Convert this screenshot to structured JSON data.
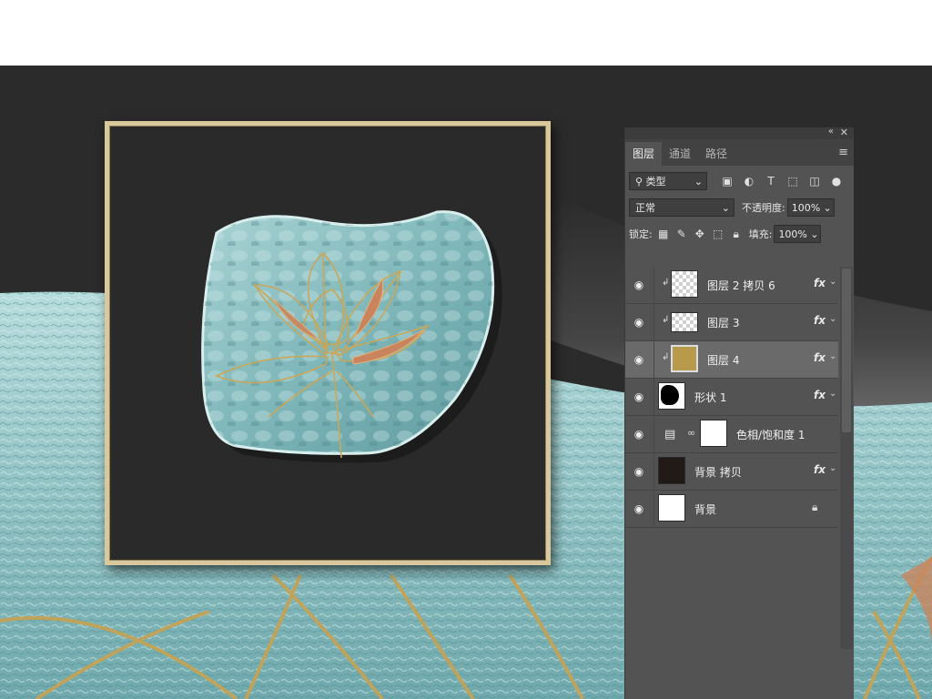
{
  "top_title": "",
  "panel": {
    "tabs": [
      {
        "label": "图层",
        "active": true
      },
      {
        "label": "通道",
        "active": false
      },
      {
        "label": "路径",
        "active": false
      }
    ],
    "filter_kind": "类型",
    "blend_mode": "正常",
    "opacity_label": "不透明度:",
    "opacity_value": "100%",
    "lock_label": "锁定:",
    "fill_label": "填充:",
    "fill_value": "100%",
    "layers": [
      {
        "name": "图层 2 拷贝 6",
        "fx": "fx",
        "clipped": true,
        "selected": false
      },
      {
        "name": "图层 3",
        "fx": "fx",
        "clipped": true,
        "selected": false
      },
      {
        "name": "图层 4",
        "fx": "fx",
        "clipped": true,
        "selected": true
      },
      {
        "name": "形状 1",
        "fx": "fx",
        "clipped": false,
        "selected": false
      },
      {
        "name": "色相/饱和度 1",
        "fx": "",
        "clipped": false,
        "selected": false
      },
      {
        "name": "背景 拷贝",
        "fx": "fx",
        "clipped": false,
        "selected": false
      },
      {
        "name": "背景",
        "fx": "",
        "clipped": false,
        "selected": false
      }
    ]
  },
  "colors": {
    "canvas_dark": "#2b2b2b",
    "teal_texture": "#8fc2c4",
    "gold_line": "#c9a75a",
    "copper_petal": "#c9845e",
    "panel_bg": "#535353",
    "panel_selected": "#6a6a6a"
  },
  "icons": {
    "eye": "eye-icon",
    "lock": "lock-icon",
    "chain": "chain-link-icon",
    "menu": "panel-menu-icon"
  }
}
